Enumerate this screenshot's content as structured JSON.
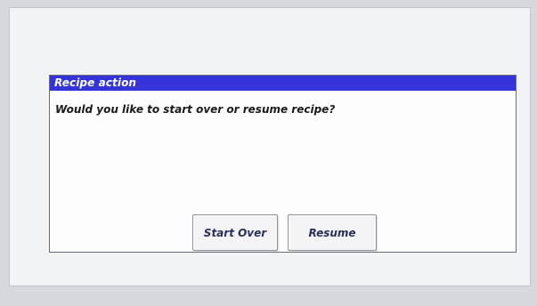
{
  "dialog": {
    "title": "Recipe action",
    "message": "Would you like to start over or resume recipe?",
    "buttons": {
      "start_over": "Start Over",
      "resume": "Resume"
    }
  },
  "colors": {
    "titlebar": "#3434d8",
    "title_text": "#ffffff",
    "dialog_bg": "#fdfdfd",
    "screen_bg": "#f2f3f5",
    "button_text": "#2a2f57"
  }
}
